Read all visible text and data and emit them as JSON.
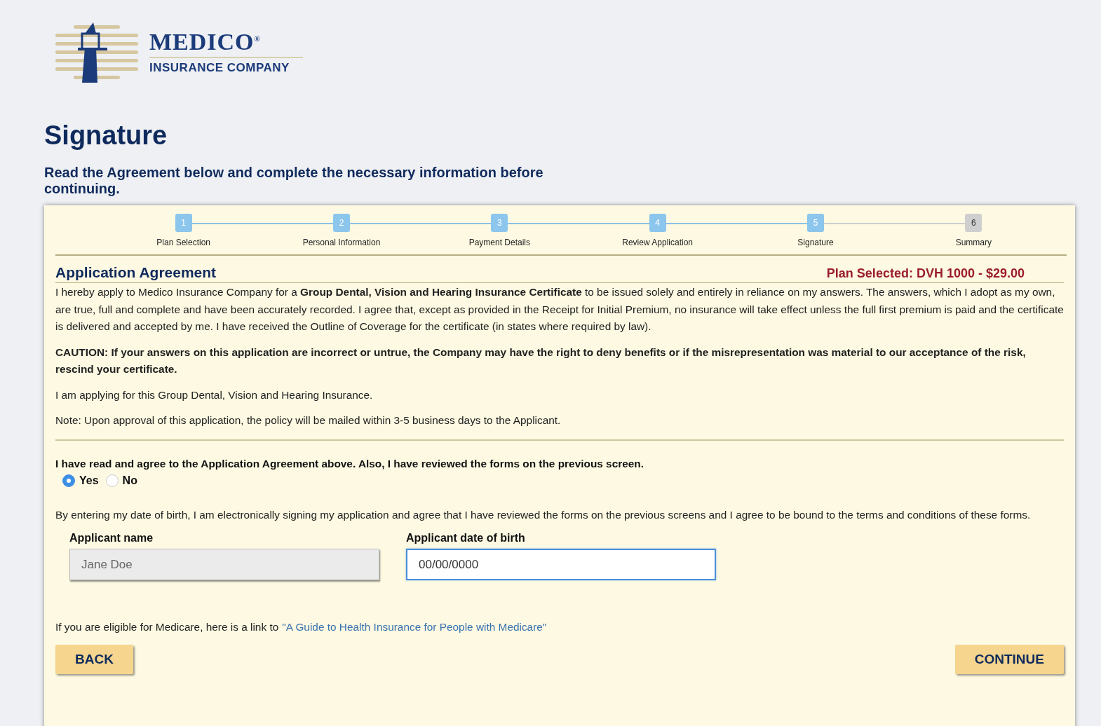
{
  "logo": {
    "name": "MEDICO$^{®}$",
    "tagline": "INSURANCE COMPANY"
  },
  "page": {
    "title": "Signature",
    "subtitle": "Read the Agreement below and complete the necessary information before continuing."
  },
  "steps": [
    {
      "number": "1",
      "label": "Plan Selection",
      "done": true
    },
    {
      "number": "2",
      "label": "Personal Information",
      "done": true
    },
    {
      "number": "3",
      "label": "Payment Details",
      "done": true
    },
    {
      "number": "4",
      "label": "Review Application",
      "done": true
    },
    {
      "number": "5",
      "label": "Signature",
      "done": true
    },
    {
      "number": "6",
      "label": "Summary",
      "done": false
    }
  ],
  "agreement": {
    "title": "Application Agreement",
    "plan": "Plan Selected: DVH 1000 - $29.00",
    "paragraphs": [
      {
        "kind": "normal",
        "text": "I hereby apply to Medico Insurance Company for a **Group Dental, Vision and Hearing Insurance Certificate** to be issued solely and entirely in reliance on my answers. The answers, which I adopt as my own, are true, full and complete and have been accurately recorded. I agree that, except as provided in the Receipt for Initial Premium, no insurance will take effect unless the full first premium is paid and the certificate is delivered and accepted by me. I have received the Outline of Coverage for the certificate (in states where required by law)."
      },
      {
        "kind": "bold",
        "text": "CAUTION: If your answers on this application are incorrect or untrue, the Company may have the right to deny benefits or if the misrepresentation was material to our acceptance of the risk, rescind your certificate."
      },
      {
        "kind": "normal",
        "text": "I am applying for this Group Dental, Vision and Hearing Insurance."
      },
      {
        "kind": "normal",
        "text": "Note: Upon approval of this application, the policy will be mailed within 3-5 business days to the Applicant."
      }
    ]
  },
  "consent": {
    "question": "I have read and agree to the Application Agreement above. Also, I have reviewed the forms on the previous screen.",
    "options": [
      {
        "label": "Yes",
        "selected": true
      },
      {
        "label": "No",
        "selected": false
      }
    ],
    "statement": "By entering my date of birth, I am electronically signing my application and agree that I have reviewed the forms on the previous screens and I agree to be bound to the terms and conditions of these forms."
  },
  "fields": [
    {
      "label": "Applicant name",
      "value": "Jane Doe",
      "disabled": true,
      "focused": false
    },
    {
      "label": "Applicant date of birth",
      "value": "00/00/0000",
      "disabled": false,
      "focused": true
    }
  ],
  "medicare": {
    "text": "If you are eligible for Medicare, here is a link to",
    "link": "\"A Guide to Health Insurance for People with Medicare\""
  },
  "buttons": {
    "back": "BACK",
    "continue": "CONTINUE"
  }
}
